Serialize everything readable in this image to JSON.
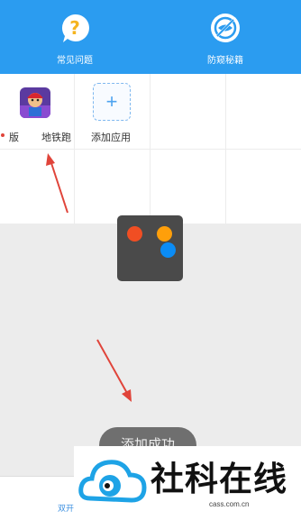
{
  "header": {
    "faq_label": "常见问题",
    "anti_peek_label": "防窥秘籍"
  },
  "app_grid": {
    "cell1_partial_label": "版",
    "cell2_label": "地铁跑",
    "cell3_label": "添加应用",
    "add_symbol": "+"
  },
  "toast": {
    "text": "添加成功"
  },
  "bottom_bar": {
    "dual_open_label": "双开"
  },
  "watermark": {
    "brand_name": "社科在线",
    "url": "cass.com.cn"
  },
  "colors": {
    "header_blue": "#2b9cf0",
    "faq_icon_yellow": "#f5b41f",
    "red_dot": "#f04e23",
    "orange_dot": "#ff9f0a",
    "blue_dot": "#0b8cf5",
    "arrow_red": "#e0443a"
  }
}
